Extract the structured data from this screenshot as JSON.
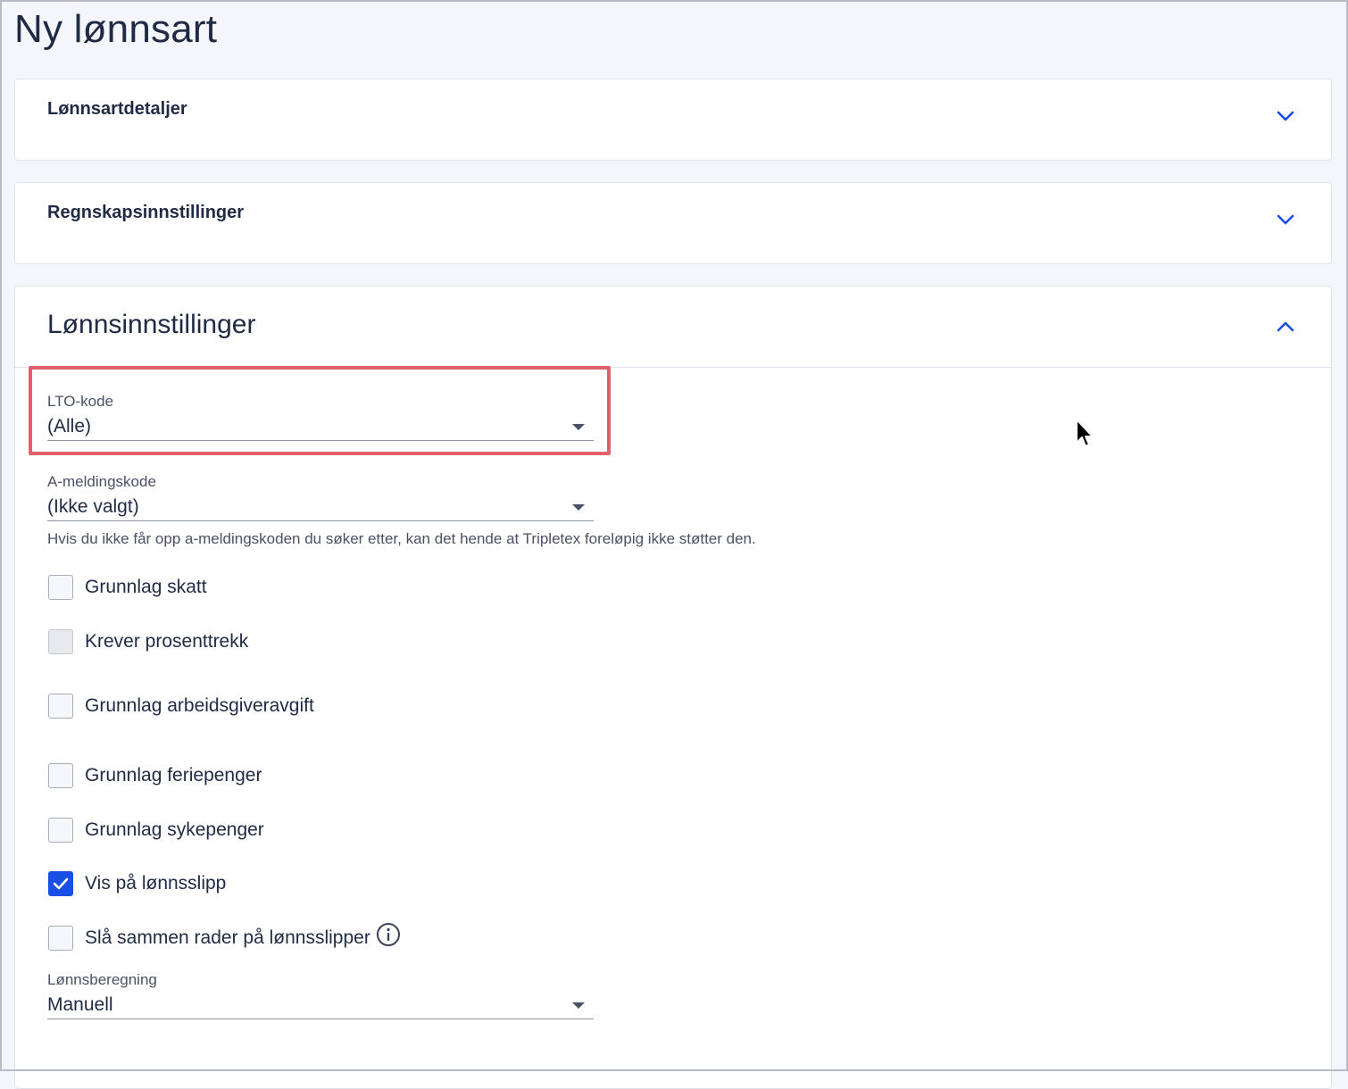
{
  "page": {
    "title": "Ny lønnsart"
  },
  "sections": {
    "details": {
      "title": "Lønnsartdetaljer",
      "icon": "chevron-down-icon"
    },
    "accounting": {
      "title": "Regnskapsinnstillinger",
      "icon": "chevron-down-icon"
    },
    "payroll": {
      "title": "Lønnsinnstillinger",
      "icon": "chevron-up-icon"
    }
  },
  "fields": {
    "lto": {
      "label": "LTO-kode",
      "value": "(Alle)"
    },
    "ameld": {
      "label": "A-meldingskode",
      "value": "(Ikke valgt)",
      "hint": "Hvis du ikke får opp a-meldingskoden du søker etter, kan det hende at Tripletex foreløpig ikke støtter den."
    },
    "calc": {
      "label": "Lønnsberegning",
      "value": "Manuell"
    }
  },
  "checkboxes": [
    {
      "label": "Grunnlag skatt",
      "checked": false,
      "disabled": false
    },
    {
      "label": "Krever prosenttrekk",
      "checked": false,
      "disabled": true
    },
    {
      "label": "Grunnlag arbeidsgiveravgift",
      "checked": false,
      "disabled": false
    },
    {
      "label": "Grunnlag feriepenger",
      "checked": false,
      "disabled": false
    },
    {
      "label": "Grunnlag sykepenger",
      "checked": false,
      "disabled": false
    },
    {
      "label": "Vis på lønnsslipp",
      "checked": true,
      "disabled": false
    },
    {
      "label": "Slå sammen rader på lønnsslipper",
      "checked": false,
      "disabled": false,
      "icon": "info-icon"
    }
  ],
  "colors": {
    "accent": "#1a4fe6",
    "highlight": "#e0606e",
    "text": "#1f2a44"
  }
}
